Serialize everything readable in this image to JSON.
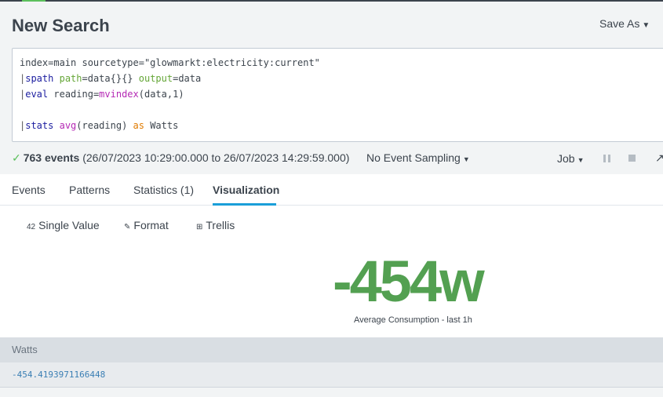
{
  "header": {
    "title": "New Search",
    "save_as": "Save As"
  },
  "search": {
    "lines": [
      {
        "parts": [
          {
            "t": "index=main sourcetype=\"glowmarkt:electricity:current\"",
            "c": ""
          }
        ]
      },
      {
        "parts": [
          {
            "t": "|",
            "c": "pipe"
          },
          {
            "t": "spath",
            "c": "kw-cmd"
          },
          {
            "t": " ",
            "c": ""
          },
          {
            "t": "path",
            "c": "kw-arg"
          },
          {
            "t": "=data{}{} ",
            "c": ""
          },
          {
            "t": "output",
            "c": "kw-arg"
          },
          {
            "t": "=data",
            "c": ""
          }
        ]
      },
      {
        "parts": [
          {
            "t": "|",
            "c": "pipe"
          },
          {
            "t": "eval",
            "c": "kw-cmd"
          },
          {
            "t": " reading=",
            "c": ""
          },
          {
            "t": "mvindex",
            "c": "kw-fn"
          },
          {
            "t": "(data,1)",
            "c": ""
          }
        ]
      },
      {
        "parts": [
          {
            "t": "",
            "c": ""
          }
        ]
      },
      {
        "parts": [
          {
            "t": "|",
            "c": "pipe"
          },
          {
            "t": "stats",
            "c": "kw-cmd"
          },
          {
            "t": " ",
            "c": ""
          },
          {
            "t": "avg",
            "c": "kw-fn"
          },
          {
            "t": "(reading) ",
            "c": ""
          },
          {
            "t": "as",
            "c": "kw-as"
          },
          {
            "t": " Watts",
            "c": ""
          }
        ]
      }
    ]
  },
  "status": {
    "count": "763 events",
    "range": "(26/07/2023 10:29:00.000 to 26/07/2023 14:29:59.000)",
    "sampling": "No Event Sampling",
    "job": "Job"
  },
  "tabs": [
    {
      "label": "Events"
    },
    {
      "label": "Patterns"
    },
    {
      "label": "Statistics (1)"
    },
    {
      "label": "Visualization"
    }
  ],
  "viz_toolbar": {
    "single_value": "Single Value",
    "single_value_icon": "42",
    "format": "Format",
    "trellis": "Trellis"
  },
  "single_value": {
    "value": "-454w",
    "caption": "Average Consumption - last 1h",
    "color": "#53a051"
  },
  "table": {
    "columns": [
      "Watts"
    ],
    "rows": [
      [
        "-454.4193971166448"
      ]
    ]
  }
}
